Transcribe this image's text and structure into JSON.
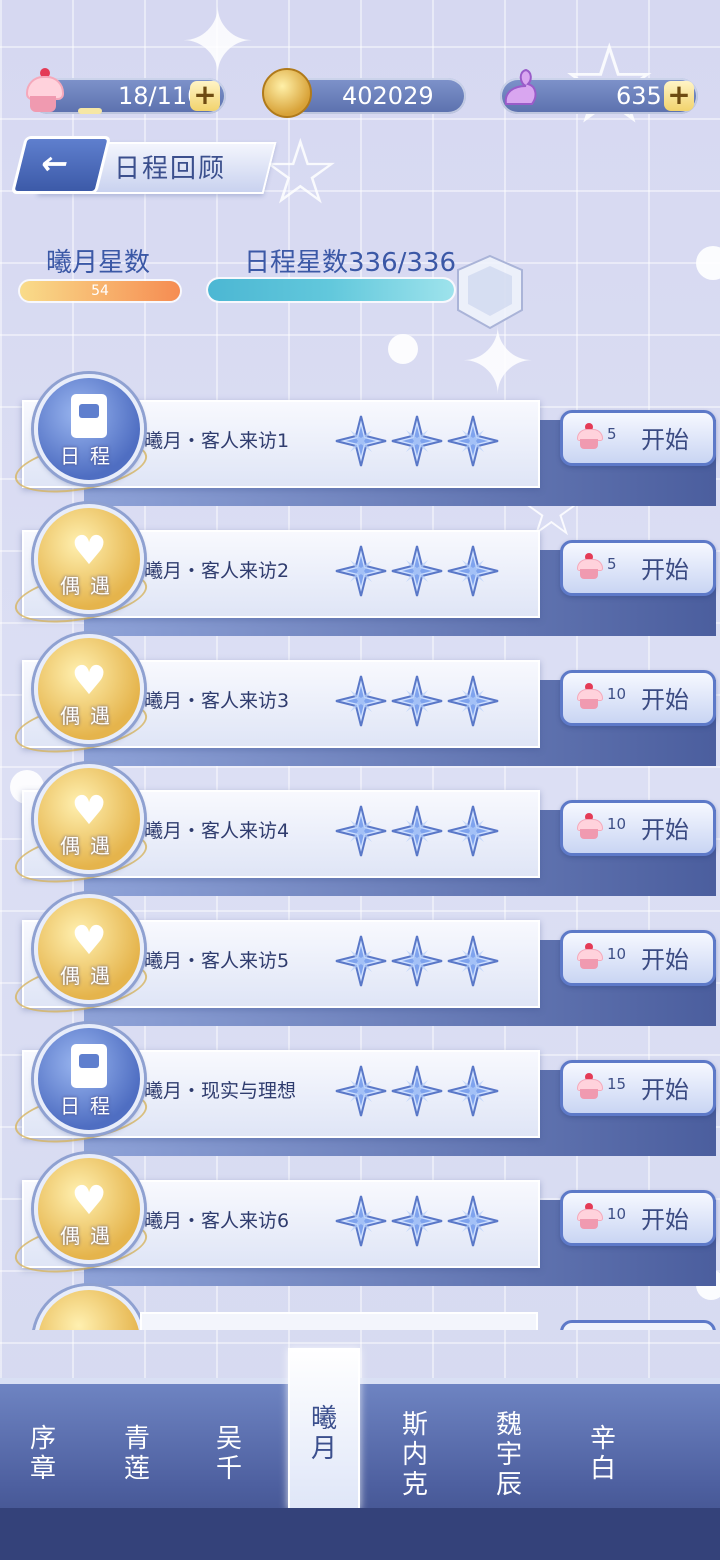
{
  "resources": {
    "stamina": {
      "value": "18/110",
      "icon": "cupcake-icon",
      "fill": 0.16
    },
    "coins": {
      "value": "402029",
      "icon": "coin-icon"
    },
    "diamonds": {
      "value": "635",
      "icon": "swan-crystal-icon"
    },
    "plus": "+"
  },
  "header": {
    "back_icon": "←",
    "title": "日程回顾"
  },
  "stats": {
    "char_stars_label": "曦月星数",
    "char_stars_value": "54",
    "schedule_stars_label": "日程星数336/336",
    "schedule_progress": 1.0
  },
  "rows": [
    {
      "badge": "schedule",
      "badge_cap": "日程",
      "title": "曦月・客人来访1",
      "stars": 3,
      "cost": "5",
      "start": "开始"
    },
    {
      "badge": "meet",
      "badge_cap": "偶遇",
      "title": "曦月・客人来访2",
      "stars": 3,
      "cost": "5",
      "start": "开始"
    },
    {
      "badge": "meet",
      "badge_cap": "偶遇",
      "title": "曦月・客人来访3",
      "stars": 3,
      "cost": "10",
      "start": "开始"
    },
    {
      "badge": "meet",
      "badge_cap": "偶遇",
      "title": "曦月・客人来访4",
      "stars": 3,
      "cost": "10",
      "start": "开始"
    },
    {
      "badge": "meet",
      "badge_cap": "偶遇",
      "title": "曦月・客人来访5",
      "stars": 3,
      "cost": "10",
      "start": "开始"
    },
    {
      "badge": "schedule",
      "badge_cap": "日程",
      "title": "曦月・现实与理想",
      "stars": 3,
      "cost": "15",
      "start": "开始"
    },
    {
      "badge": "meet",
      "badge_cap": "偶遇",
      "title": "曦月・客人来访6",
      "stars": 3,
      "cost": "10",
      "start": "开始"
    }
  ],
  "tabs": [
    "序章",
    "青莲",
    "吴千",
    "曦月",
    "斯内克",
    "魏宇辰",
    "辛白"
  ],
  "active_tab": "曦月",
  "colors": {
    "accent": "#5d79c8",
    "title": "#3b4f8d",
    "gold": "#e5b44c"
  }
}
